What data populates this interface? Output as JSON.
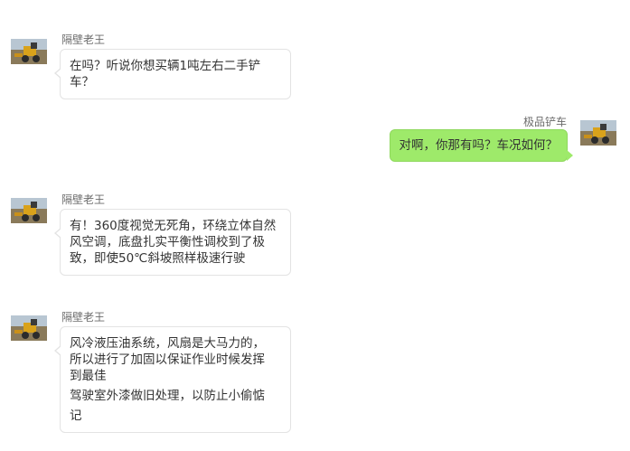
{
  "messages": [
    {
      "sender": "隔壁老王",
      "side": "left",
      "lines": [
        "在吗？听说你想买辆1吨左右二手铲",
        "车？"
      ]
    },
    {
      "sender": "极品铲车",
      "side": "right",
      "lines": [
        "对啊，你那有吗？车况如何？"
      ]
    },
    {
      "sender": "隔壁老王",
      "side": "left",
      "lines": [
        "有！360度视觉无死角，环绕立体自然",
        "风空调，底盘扎实平衡性调校到了极",
        "致，即使50℃斜坡照样极速行驶"
      ]
    },
    {
      "sender": "隔壁老王",
      "side": "left",
      "lines": [
        "风冷液压油系统，风扇是大马力的，",
        "所以进行了加固以保证作业时候发挥",
        "到最佳",
        "驾驶室外漆做旧处理，以防止小偷惦",
        "记"
      ]
    }
  ],
  "colors": {
    "self_bubble": "#9eea6a",
    "other_bubble": "#ffffff",
    "sender_name": "#6b6b6b"
  }
}
